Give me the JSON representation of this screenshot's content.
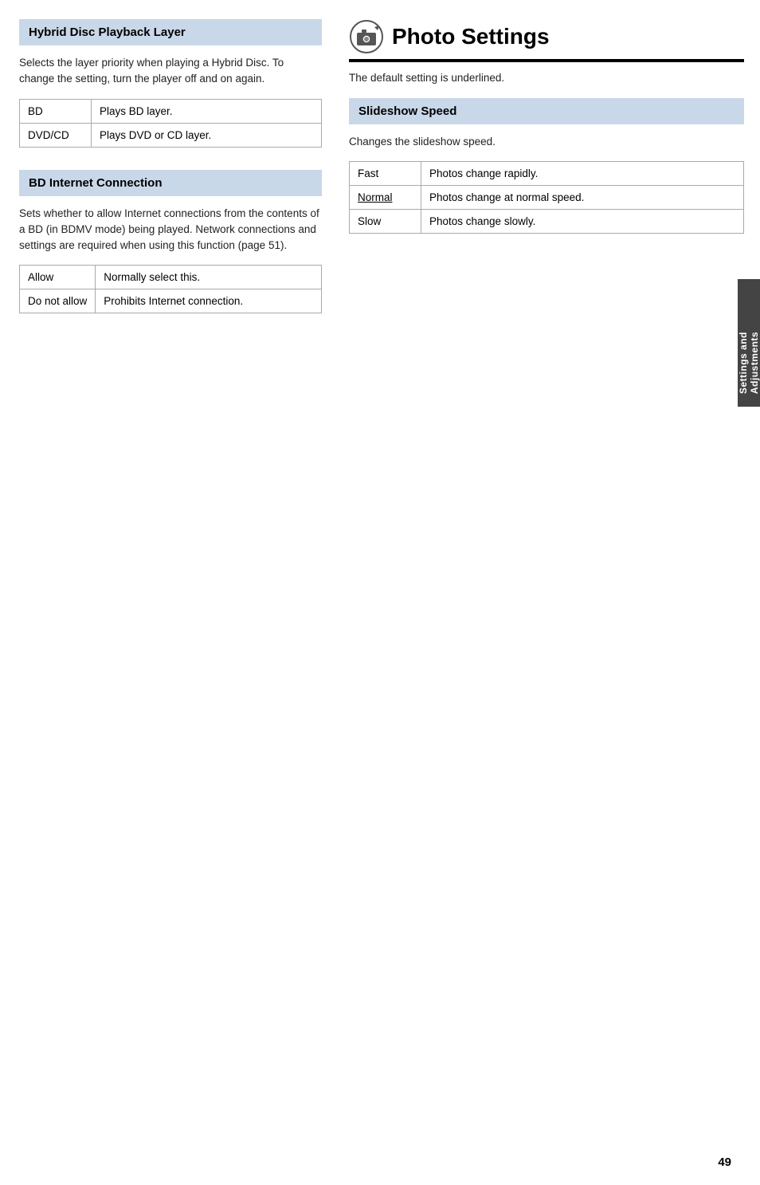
{
  "left_column": {
    "hybrid_section": {
      "header": "Hybrid Disc Playback Layer",
      "body": "Selects the layer priority when playing a Hybrid Disc. To change the setting, turn the player off and on again.",
      "table": [
        {
          "option": "BD",
          "description": "Plays BD layer."
        },
        {
          "option": "DVD/CD",
          "description": "Plays DVD or CD layer."
        }
      ]
    },
    "bd_internet_section": {
      "header": "BD Internet Connection",
      "body": "Sets whether to allow Internet connections from the contents of a BD (in BDMV mode) being played. Network connections and settings are required when using this function (page 51).",
      "table": [
        {
          "option": "Allow",
          "description": "Normally select this."
        },
        {
          "option": "Do not allow",
          "description": "Prohibits Internet connection."
        }
      ]
    }
  },
  "right_column": {
    "page_title": "Photo Settings",
    "default_note": "The default setting is underlined.",
    "slideshow_section": {
      "header": "Slideshow Speed",
      "body": "Changes the slideshow speed.",
      "table": [
        {
          "option": "Fast",
          "description": "Photos change rapidly.",
          "underlined": false
        },
        {
          "option": "Normal",
          "description": "Photos change at normal speed.",
          "underlined": true
        },
        {
          "option": "Slow",
          "description": "Photos change slowly.",
          "underlined": false
        }
      ]
    }
  },
  "side_tab": {
    "label": "Settings and Adjustments"
  },
  "page_number": "49"
}
